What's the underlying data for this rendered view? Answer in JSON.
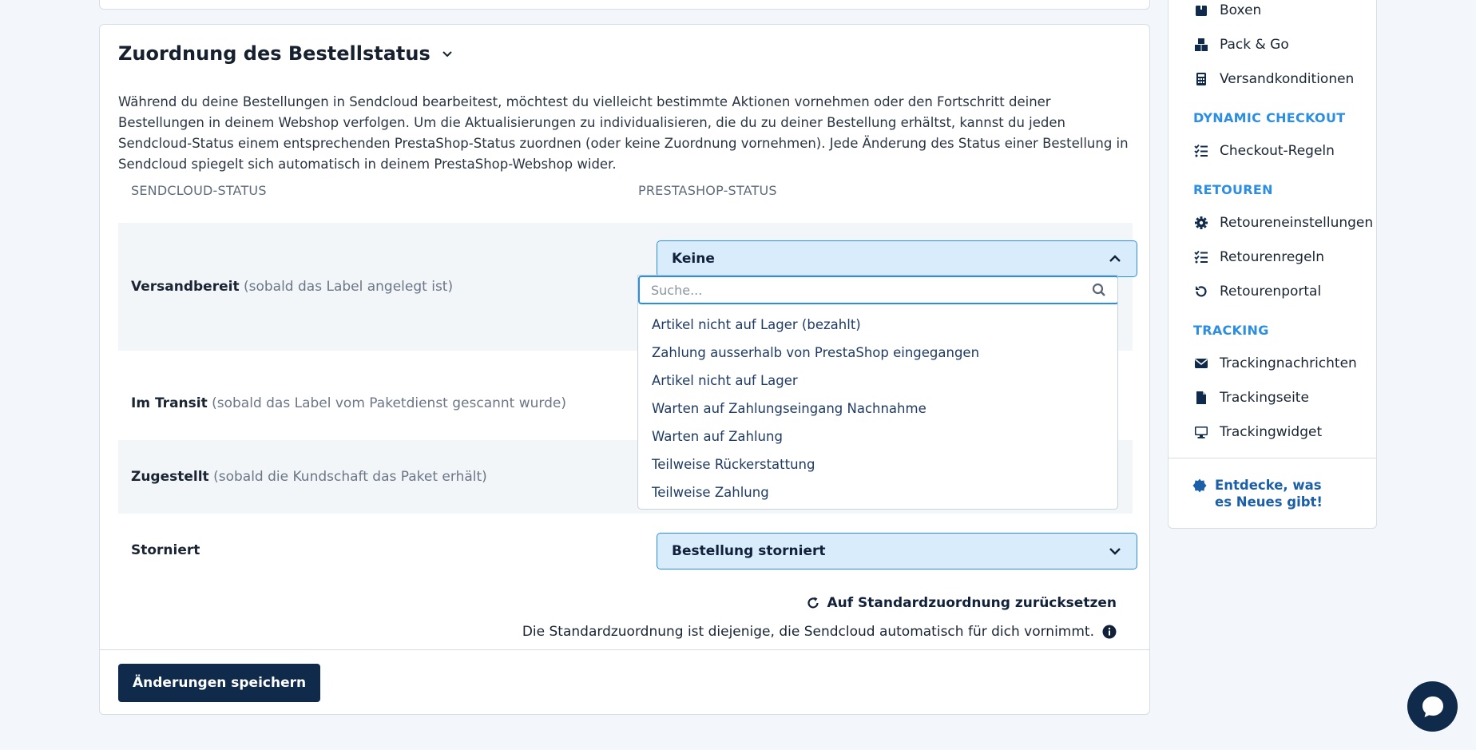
{
  "section": {
    "title": "Zuordnung des Bestellstatus",
    "description": "Während du deine Bestellungen in Sendcloud bearbeitest, möchtest du vielleicht bestimmte Aktionen vornehmen oder den Fortschritt deiner Bestellungen in deinem Webshop verfolgen. Um die Aktualisierungen zu individualisieren, die du zu deiner Bestellung erhältst, kannst du jeden Sendcloud-Status einem entsprechenden PrestaShop-Status zuordnen (oder keine Zuordnung vornehmen). Jede Änderung des Status einer Bestellung in Sendcloud spiegelt sich automatisch in deinem PrestaShop-Webshop wider."
  },
  "table": {
    "col_sendcloud": "SENDCLOUD-STATUS",
    "col_prestashop": "PRESTASHOP-STATUS",
    "rows": [
      {
        "status": "Versandbereit",
        "hint": "(sobald das Label angelegt ist)",
        "selected": "Keine"
      },
      {
        "status": "Im Transit",
        "hint": "(sobald das Label vom Paketdienst gescannt wurde)",
        "selected": ""
      },
      {
        "status": "Zugestellt",
        "hint": "(sobald die Kundschaft das Paket erhält)",
        "selected": ""
      },
      {
        "status": "Storniert",
        "hint": "",
        "selected": "Bestellung storniert"
      }
    ]
  },
  "dropdown": {
    "search_placeholder": "Suche...",
    "options": [
      "Artikel nicht auf Lager (bezahlt)",
      "Zahlung ausserhalb von PrestaShop eingegangen",
      "Artikel nicht auf Lager",
      "Warten auf Zahlungseingang Nachnahme",
      "Warten auf Zahlung",
      "Teilweise Rückerstattung",
      "Teilweise Zahlung"
    ]
  },
  "reset": {
    "link": "Auf Standardzuordnung zurücksetzen",
    "note": "Die Standardzuordnung ist diejenige, die Sendcloud automatisch für dich vornimmt."
  },
  "save_label": "Änderungen speichern",
  "sidebar": {
    "items_top": [
      {
        "label": "Boxen",
        "icon": "box-icon"
      },
      {
        "label": "Pack & Go",
        "icon": "boxes-icon"
      },
      {
        "label": "Versandkonditionen",
        "icon": "calculator-icon"
      }
    ],
    "dynamic_checkout_head": "DYNAMIC CHECKOUT",
    "dynamic_checkout_items": [
      {
        "label": "Checkout-Regeln",
        "icon": "list-check-icon"
      }
    ],
    "returns_head": "RETOUREN",
    "returns_items": [
      {
        "label": "Retoureneinstellungen",
        "icon": "gear-icon"
      },
      {
        "label": "Retourenregeln",
        "icon": "list-check-icon"
      },
      {
        "label": "Retourenportal",
        "icon": "undo-icon"
      }
    ],
    "tracking_head": "TRACKING",
    "tracking_items": [
      {
        "label": "Trackingnachrichten",
        "icon": "envelope-icon"
      },
      {
        "label": "Trackingseite",
        "icon": "file-icon"
      },
      {
        "label": "Trackingwidget",
        "icon": "monitor-icon"
      }
    ],
    "news_label": "Entdecke, was es Neues gibt!"
  },
  "colors": {
    "accent": "#2b8ee0",
    "navy": "#102a4c",
    "select_bg": "#d8ecfc"
  }
}
